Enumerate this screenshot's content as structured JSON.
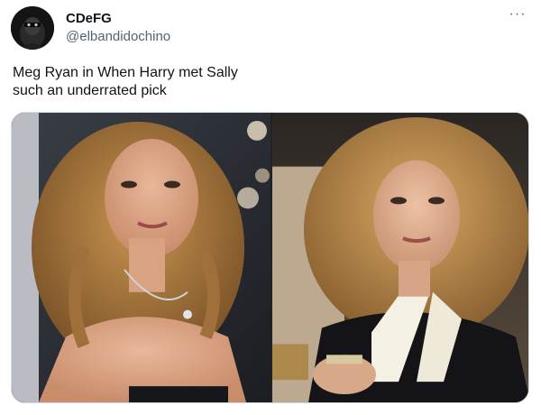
{
  "author": {
    "display_name": "CDeFG",
    "handle": "@elbandidochino",
    "avatar_icon": "masked-figure-avatar"
  },
  "menu": {
    "more_icon": "more-dots-icon",
    "more_glyph": "···"
  },
  "tweet": {
    "text_lines": [
      "Meg Ryan in When Harry met Sally",
      "such an underrated pick"
    ]
  },
  "media": {
    "photos": [
      {
        "description_icon": "photo-left"
      },
      {
        "description_icon": "photo-right"
      }
    ]
  },
  "colors": {
    "text_primary": "#0f1419",
    "text_secondary": "#536471",
    "border": "#cfd9de"
  }
}
